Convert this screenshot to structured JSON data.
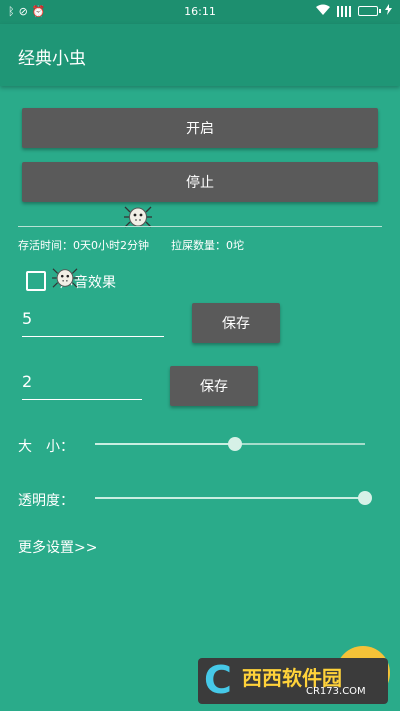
{
  "statusbar": {
    "time": "16:11"
  },
  "appbar": {
    "title": "经典小虫"
  },
  "buttons": {
    "start": "开启",
    "stop": "停止",
    "save1": "保存",
    "save2": "保存"
  },
  "stats": {
    "survive": "存活时间：0天0小时2分钟",
    "poop": "拉屎数量：0坨"
  },
  "checkbox": {
    "label": "声音效果",
    "checked": false
  },
  "fields": {
    "value1": "5",
    "value2": "2"
  },
  "settings": {
    "size_label": "大　小：",
    "size_level": 0.52,
    "opacity_label": "透明度：",
    "opacity_level": 1.0,
    "more_link": "更多设置>>"
  },
  "watermark": {
    "main": "西西软件园",
    "url": "CR173.COM"
  },
  "colors": {
    "background": "#2aab8a",
    "appbar": "#1f9676",
    "button": "#5a5a5a"
  },
  "icons": [
    "bluetooth-icon",
    "eye-off-icon",
    "alarm-icon",
    "wifi-icon",
    "signal-icon",
    "battery-icon",
    "charging-icon",
    "bug-icon"
  ]
}
